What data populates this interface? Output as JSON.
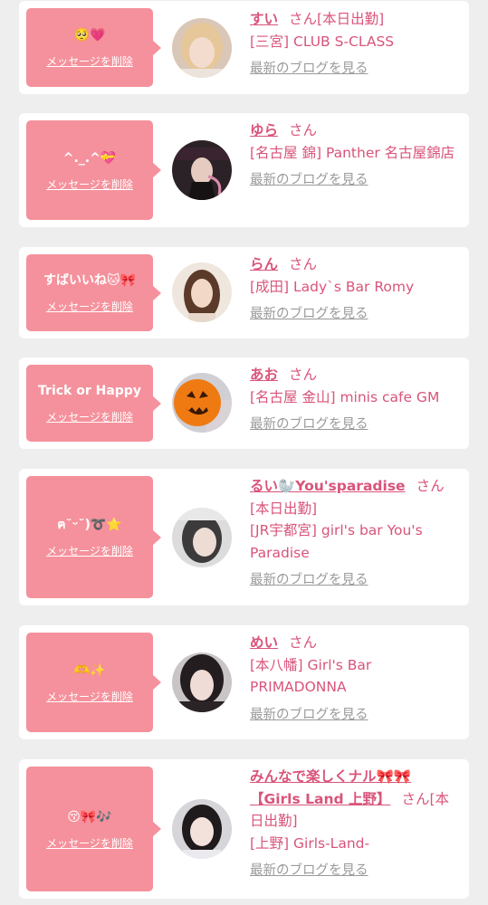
{
  "ui": {
    "delete_label": "メッセージを削除",
    "blog_label": "最新のブログを見る",
    "honorific": "さん",
    "accent_color": "#f5919c",
    "name_color": "#d9547a"
  },
  "entries": [
    {
      "message": "🥺💗",
      "name": "すい",
      "status": "[本日出勤]",
      "shop": "[三宮] CLUB S-CLASS",
      "avatar_icon": "woman-portrait-icon"
    },
    {
      "message": "^._.^💝",
      "name": "ゆら",
      "status": "",
      "shop": "[名古屋 錦] Panther 名古屋錦店",
      "avatar_icon": "woman-portrait-icon"
    },
    {
      "message": "すばいいね🐱🎀",
      "name": "らん",
      "status": "",
      "shop": "[成田] Lady`s Bar Romy",
      "avatar_icon": "woman-portrait-icon"
    },
    {
      "message": "Trick or Happy",
      "name": "あお",
      "status": "",
      "shop": "[名古屋 金山] minis cafe GM",
      "avatar_icon": "pumpkin-icon"
    },
    {
      "message": "ฅ˘ᵕ˘)➰⭐",
      "name": "るい🦭You'sparadise",
      "status": "[本日出勤]",
      "shop": "[JR宇都宮] girl's bar You's Paradise",
      "avatar_icon": "woman-portrait-icon"
    },
    {
      "message": "🫶✨",
      "name": "めい",
      "status": "",
      "shop": "[本八幡] Girl's Bar PRIMADONNA",
      "avatar_icon": "woman-portrait-icon"
    },
    {
      "message": "😚🎀🎶",
      "name": "みんなで楽しくナル🎀🎀【Girls Land 上野】",
      "status": "[本日出勤]",
      "shop": "[上野] Girls-Land-",
      "avatar_icon": "woman-portrait-icon"
    }
  ]
}
